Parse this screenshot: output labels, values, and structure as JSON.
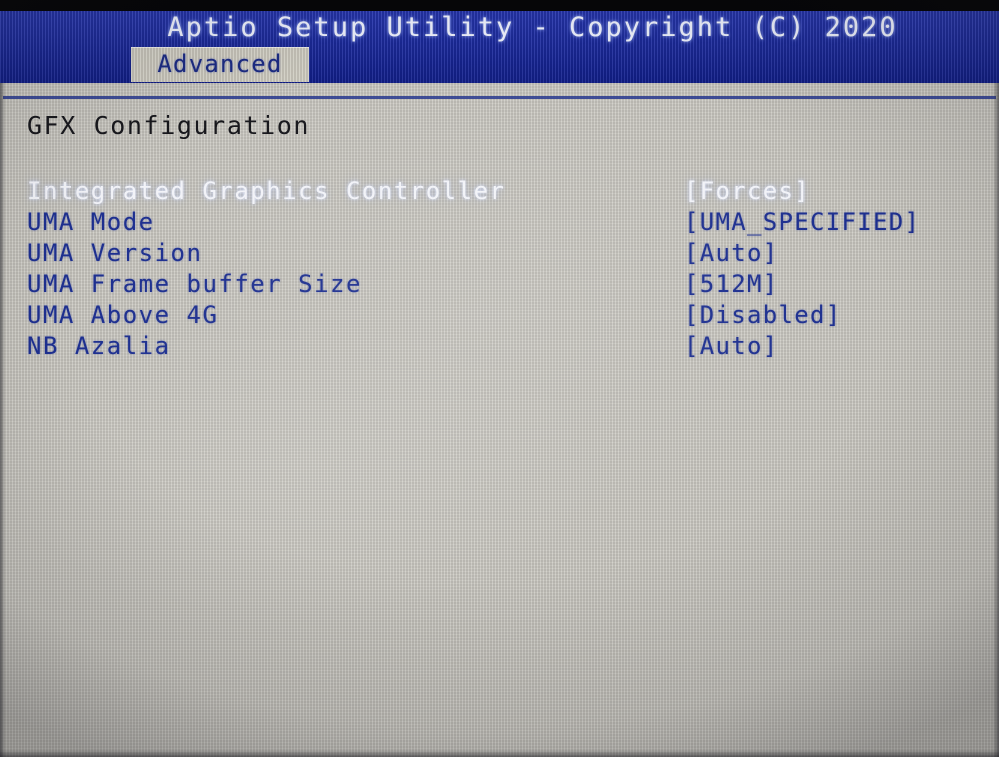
{
  "window": {
    "title": "Aptio Setup Utility - Copyright (C) 2020",
    "tab_label": "Advanced"
  },
  "section": {
    "title": "GFX Configuration"
  },
  "settings": {
    "rows": [
      {
        "label": "Integrated Graphics Controller",
        "value": "[Forces]",
        "selected": true
      },
      {
        "label": "UMA Mode",
        "value": "[UMA_SPECIFIED]",
        "selected": false
      },
      {
        "label": "UMA Version",
        "value": "[Auto]",
        "selected": false
      },
      {
        "label": "UMA Frame buffer Size",
        "value": "[512M]",
        "selected": false
      },
      {
        "label": "UMA Above 4G",
        "value": "[Disabled]",
        "selected": false
      },
      {
        "label": "NB Azalia",
        "value": "[Auto]",
        "selected": false
      }
    ]
  },
  "colors": {
    "header_blue": "#1526ad",
    "panel_gray": "#c9c7c0",
    "tab_gray": "#cdcabf",
    "label_blue": "#1d2f8f",
    "selected_white": "#f2f3f8",
    "section_title": "#17171c",
    "rule_blue": "#2a3a8e"
  }
}
